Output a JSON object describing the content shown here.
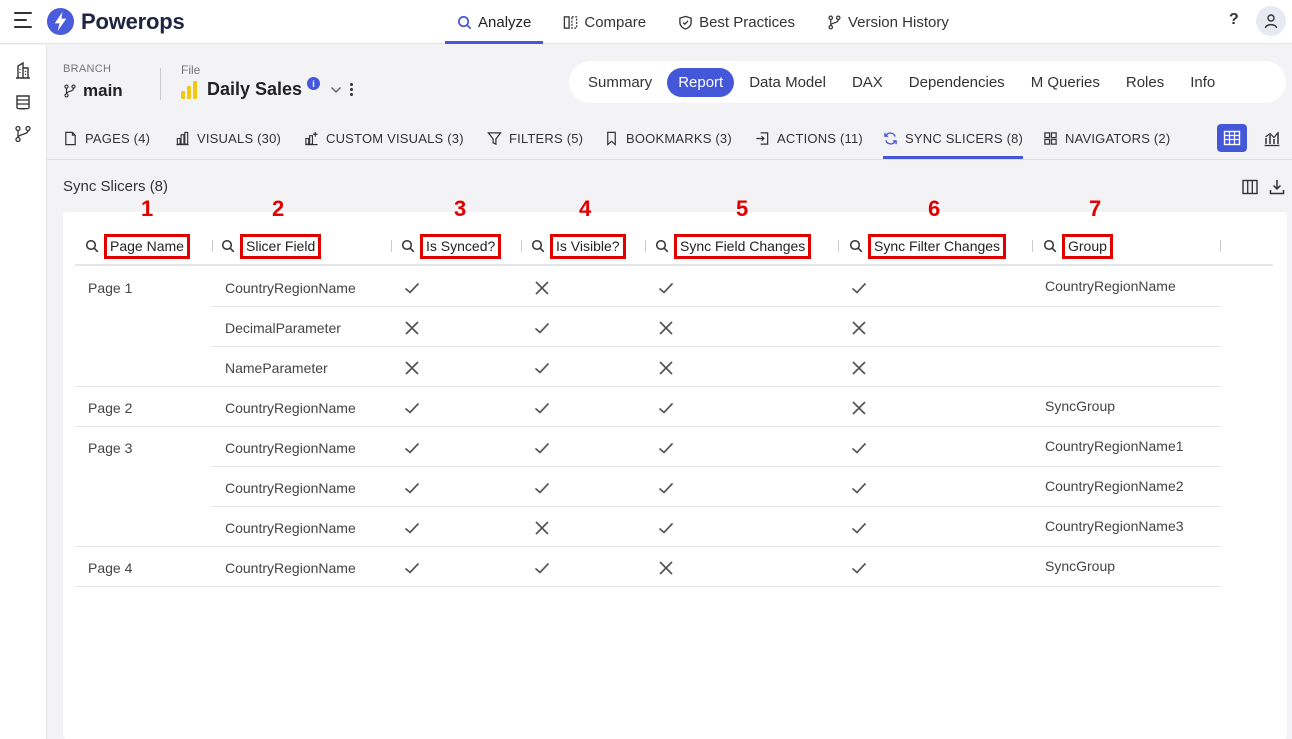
{
  "app": {
    "name": "Powerops"
  },
  "topnav": [
    {
      "label": "Analyze",
      "icon": "search-icon",
      "active": true
    },
    {
      "label": "Compare",
      "icon": "compare-icon",
      "active": false
    },
    {
      "label": "Best Practices",
      "icon": "shield-icon",
      "active": false
    },
    {
      "label": "Version History",
      "icon": "branch-icon",
      "active": false
    }
  ],
  "help_label": "?",
  "branch": {
    "label": "BRANCH",
    "value": "main"
  },
  "file": {
    "label": "File",
    "value": "Daily Sales",
    "info": "i"
  },
  "pill_tabs": [
    "Summary",
    "Report",
    "Data Model",
    "DAX",
    "Dependencies",
    "M Queries",
    "Roles",
    "Info"
  ],
  "pill_active": "Report",
  "subtabs": [
    {
      "label": "PAGES (4)",
      "icon": "page-icon"
    },
    {
      "label": "VISUALS (30)",
      "icon": "bar-chart-icon"
    },
    {
      "label": "CUSTOM VISUALS (3)",
      "icon": "custom-visual-icon"
    },
    {
      "label": "FILTERS (5)",
      "icon": "filter-icon"
    },
    {
      "label": "BOOKMARKS (3)",
      "icon": "bookmark-icon"
    },
    {
      "label": "ACTIONS (11)",
      "icon": "action-icon"
    },
    {
      "label": "SYNC SLICERS (8)",
      "icon": "sync-icon",
      "active": true
    },
    {
      "label": "NAVIGATORS (2)",
      "icon": "grid-icon"
    }
  ],
  "section_title": "Sync Slicers (8)",
  "columns": [
    {
      "num": "1",
      "label": "Page Name"
    },
    {
      "num": "2",
      "label": "Slicer Field"
    },
    {
      "num": "3",
      "label": "Is Synced?"
    },
    {
      "num": "4",
      "label": "Is Visible?"
    },
    {
      "num": "5",
      "label": "Sync Field Changes"
    },
    {
      "num": "6",
      "label": "Sync Filter Changes"
    },
    {
      "num": "7",
      "label": "Group"
    }
  ],
  "rows": [
    {
      "page": "Page 1",
      "field": "CountryRegionName",
      "synced": true,
      "visible": false,
      "field_changes": true,
      "filter_changes": true,
      "group": "CountryRegionName"
    },
    {
      "page": "",
      "field": "DecimalParameter",
      "synced": false,
      "visible": true,
      "field_changes": false,
      "filter_changes": false,
      "group": ""
    },
    {
      "page": "",
      "field": "NameParameter",
      "synced": false,
      "visible": true,
      "field_changes": false,
      "filter_changes": false,
      "group": ""
    },
    {
      "page": "Page 2",
      "field": "CountryRegionName",
      "synced": true,
      "visible": true,
      "field_changes": true,
      "filter_changes": false,
      "group": "SyncGroup"
    },
    {
      "page": "Page 3",
      "field": "CountryRegionName",
      "synced": true,
      "visible": true,
      "field_changes": true,
      "filter_changes": true,
      "group": "CountryRegionName1"
    },
    {
      "page": "",
      "field": "CountryRegionName",
      "synced": true,
      "visible": true,
      "field_changes": true,
      "filter_changes": true,
      "group": "CountryRegionName2"
    },
    {
      "page": "",
      "field": "CountryRegionName",
      "synced": true,
      "visible": false,
      "field_changes": true,
      "filter_changes": true,
      "group": "CountryRegionName3"
    },
    {
      "page": "Page 4",
      "field": "CountryRegionName",
      "synced": true,
      "visible": true,
      "field_changes": false,
      "filter_changes": true,
      "group": "SyncGroup"
    }
  ],
  "colors": {
    "accent": "#4557d9",
    "highlight": "#e00000"
  }
}
